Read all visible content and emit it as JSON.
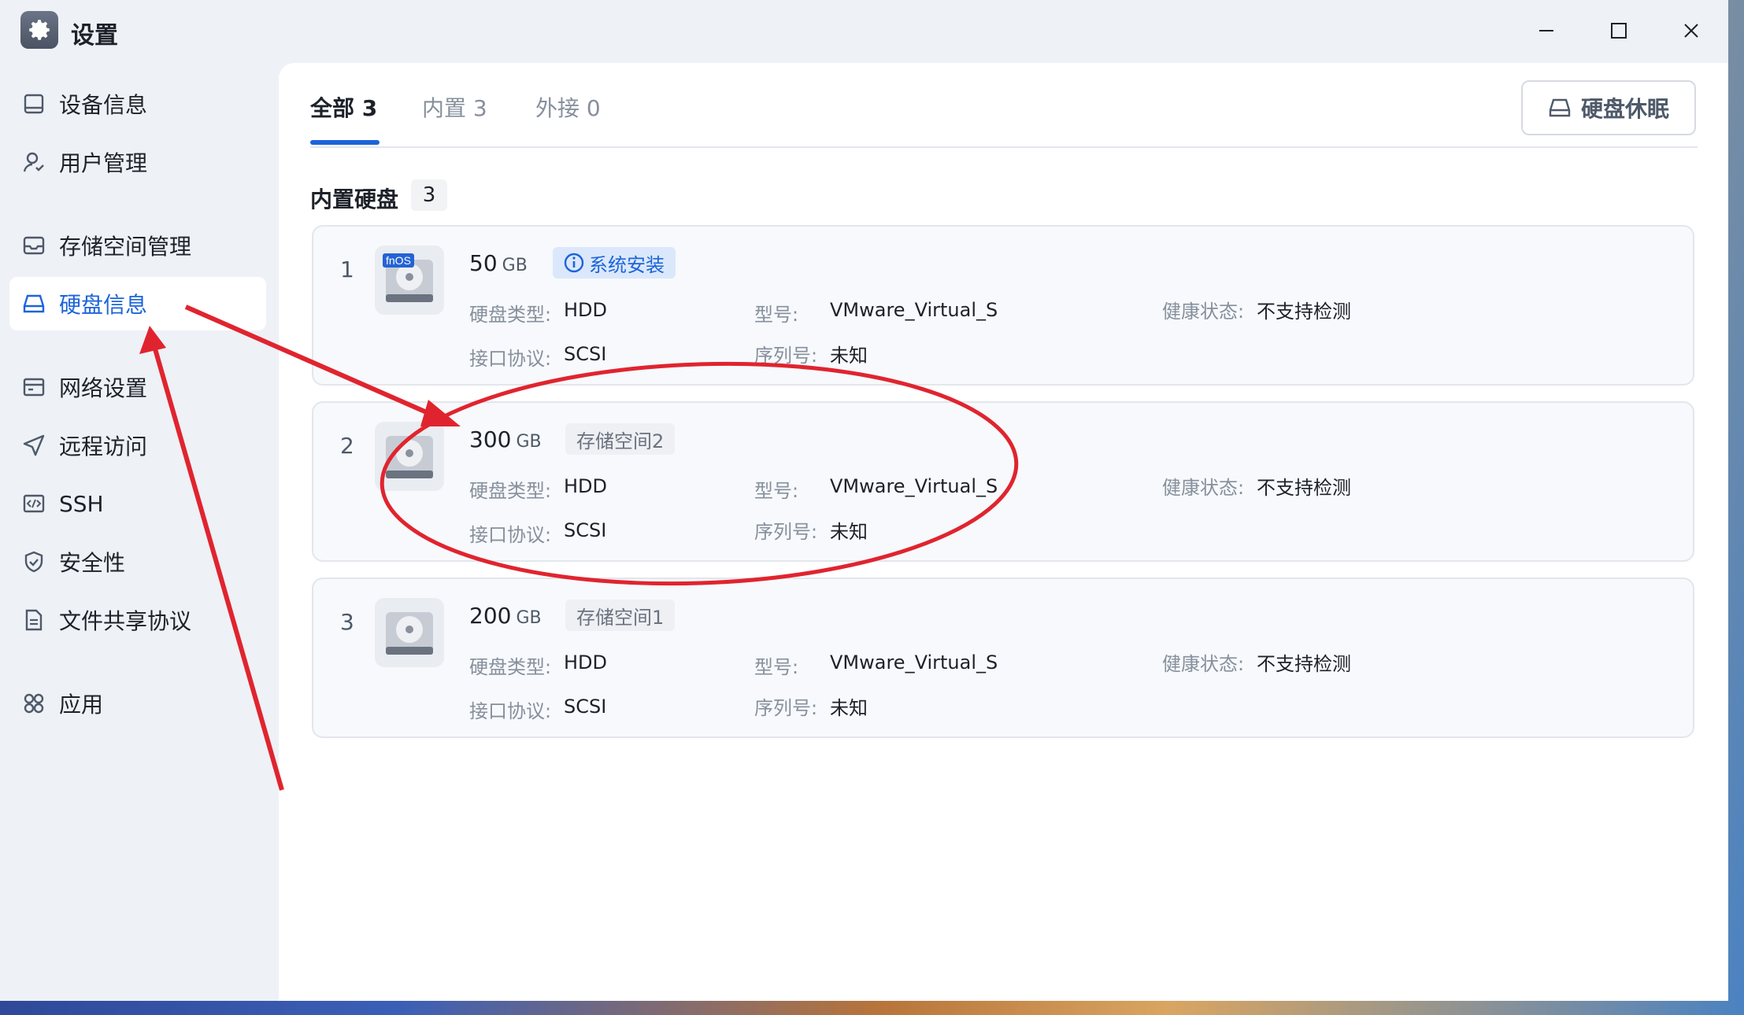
{
  "window": {
    "title": "设置",
    "icon": "gear-icon"
  },
  "sidebar": {
    "items": [
      {
        "label": "设备信息",
        "icon": "device-info-icon",
        "active": false
      },
      {
        "label": "用户管理",
        "icon": "user-icon",
        "active": false
      },
      {
        "label": "存储空间管理",
        "icon": "storage-icon",
        "active": false
      },
      {
        "label": "硬盘信息",
        "icon": "disk-icon",
        "active": true
      },
      {
        "label": "网络设置",
        "icon": "network-icon",
        "active": false
      },
      {
        "label": "远程访问",
        "icon": "send-icon",
        "active": false
      },
      {
        "label": "SSH",
        "icon": "code-icon",
        "active": false
      },
      {
        "label": "安全性",
        "icon": "shield-icon",
        "active": false
      },
      {
        "label": "文件共享协议",
        "icon": "file-icon",
        "active": false
      },
      {
        "label": "应用",
        "icon": "apps-icon",
        "active": false
      }
    ]
  },
  "tabs": [
    {
      "label": "全部 3",
      "active": true
    },
    {
      "label": "内置 3",
      "active": false
    },
    {
      "label": "外接 0",
      "active": false
    }
  ],
  "toolbar": {
    "sleep_label": "硬盘休眠"
  },
  "section": {
    "title": "内置硬盘",
    "count": "3"
  },
  "labels": {
    "disk_type": "硬盘类型:",
    "interface": "接口协议:",
    "model": "型号:",
    "serial": "序列号:",
    "health": "健康状态:"
  },
  "disks": [
    {
      "index": "1",
      "size": "50",
      "unit": "GB",
      "tag": "系统安装",
      "tag_style": "info",
      "badge": "fnOS",
      "type": "HDD",
      "interface": "SCSI",
      "model": "VMware_Virtual_S",
      "serial": "未知",
      "health": "不支持检测"
    },
    {
      "index": "2",
      "size": "300",
      "unit": "GB",
      "tag": "存储空间2",
      "tag_style": "gray",
      "type": "HDD",
      "interface": "SCSI",
      "model": "VMware_Virtual_S",
      "serial": "未知",
      "health": "不支持检测"
    },
    {
      "index": "3",
      "size": "200",
      "unit": "GB",
      "tag": "存储空间1",
      "tag_style": "gray",
      "type": "HDD",
      "interface": "SCSI",
      "model": "VMware_Virtual_S",
      "serial": "未知",
      "health": "不支持检测"
    }
  ],
  "colors": {
    "accent": "#1c64d9",
    "annotation": "#e0242f"
  }
}
